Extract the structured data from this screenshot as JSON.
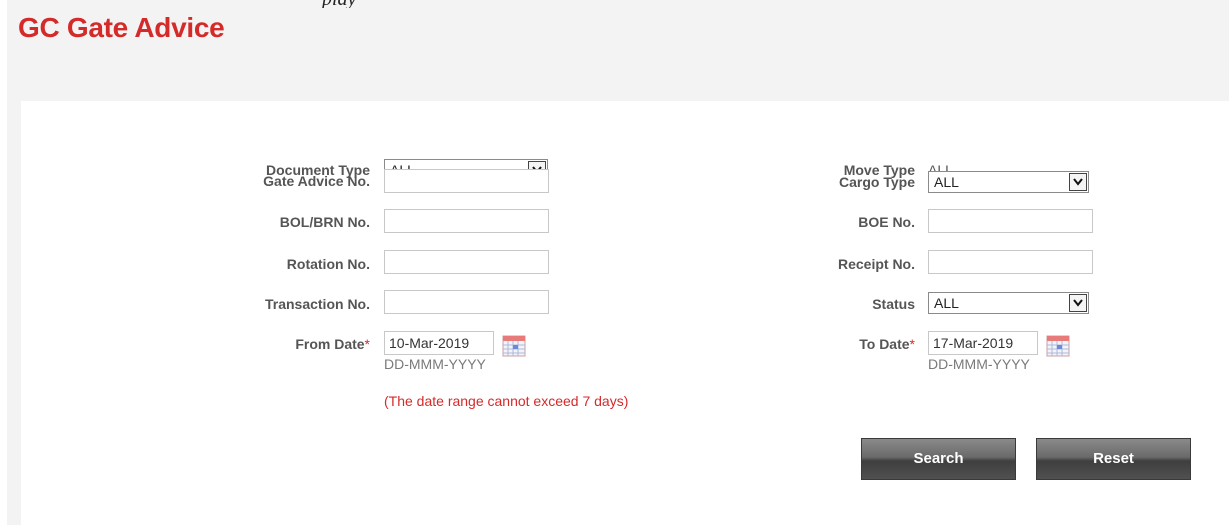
{
  "page": {
    "top_fragment": "play",
    "title": "GC Gate Advice"
  },
  "form": {
    "document_type": {
      "label": "Document Type",
      "value": "ALL"
    },
    "gate_advice_no": {
      "label": "Gate Advice No.",
      "value": ""
    },
    "bol_brn_no": {
      "label": "BOL/BRN No.",
      "value": ""
    },
    "rotation_no": {
      "label": "Rotation No.",
      "value": ""
    },
    "transaction_no": {
      "label": "Transaction No.",
      "value": ""
    },
    "from_date": {
      "label": "From Date",
      "required_mark": "*",
      "value": "10-Mar-2019",
      "hint": "DD-MMM-YYYY"
    },
    "move_type": {
      "label": "Move Type",
      "value": "ALL"
    },
    "cargo_type": {
      "label": "Cargo Type",
      "value": "ALL"
    },
    "boe_no": {
      "label": "BOE No.",
      "value": ""
    },
    "receipt_no": {
      "label": "Receipt No.",
      "value": ""
    },
    "status": {
      "label": "Status",
      "value": "ALL"
    },
    "to_date": {
      "label": "To Date",
      "required_mark": "*",
      "value": "17-Mar-2019",
      "hint": "DD-MMM-YYYY"
    },
    "date_range_warning": "(The date range cannot exceed 7 days)"
  },
  "buttons": {
    "search": "Search",
    "reset": "Reset"
  },
  "colors": {
    "title": "#d42a2a",
    "required": "#d42a2a",
    "button_dark": "#4a4a4a"
  },
  "icons": {
    "dropdown": "chevron-down-icon",
    "calendar": "calendar-icon"
  }
}
